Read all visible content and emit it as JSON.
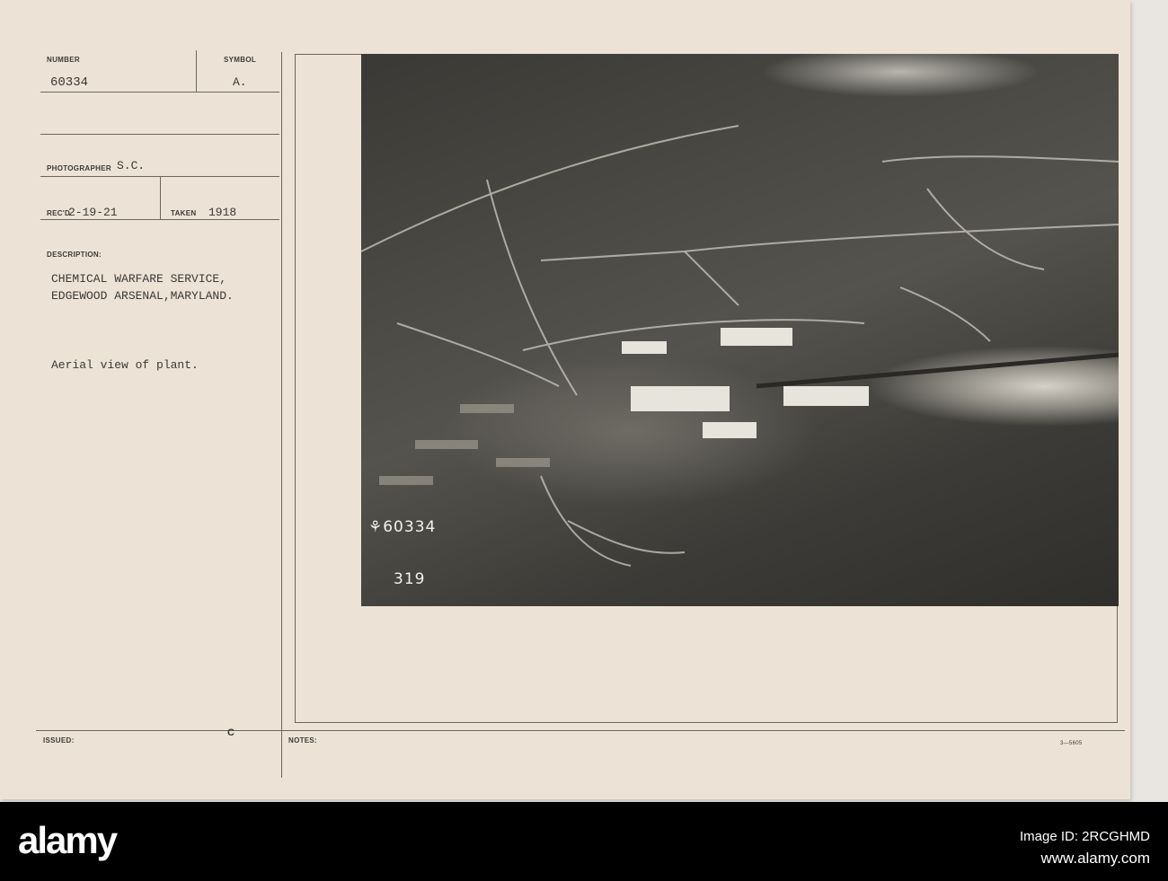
{
  "card": {
    "number_label": "NUMBER",
    "number": "60334",
    "symbol_label": "SYMBOL",
    "symbol": "A.",
    "photographer_label": "PHOTOGRAPHER",
    "photographer": "S.C.",
    "received_label": "REC'D",
    "received": "2-19-21",
    "taken_label": "TAKEN",
    "taken": "1918",
    "description_label": "DESCRIPTION:",
    "description_line1": "CHEMICAL WARFARE SERVICE,",
    "description_line2": "EDGEWOOD ARSENAL,MARYLAND.",
    "caption": "Aerial view of plant.",
    "issued_label": "ISSUED:",
    "issued_mark": "C",
    "notes_label": "NOTES:",
    "form_number": "3—5605"
  },
  "photo": {
    "handwritten_number": "⚘60334",
    "handwritten_sub": "319"
  },
  "watermark": {
    "logo": "alamy",
    "image_id": "Image ID: 2RCGHMD",
    "url": "www.alamy.com"
  }
}
